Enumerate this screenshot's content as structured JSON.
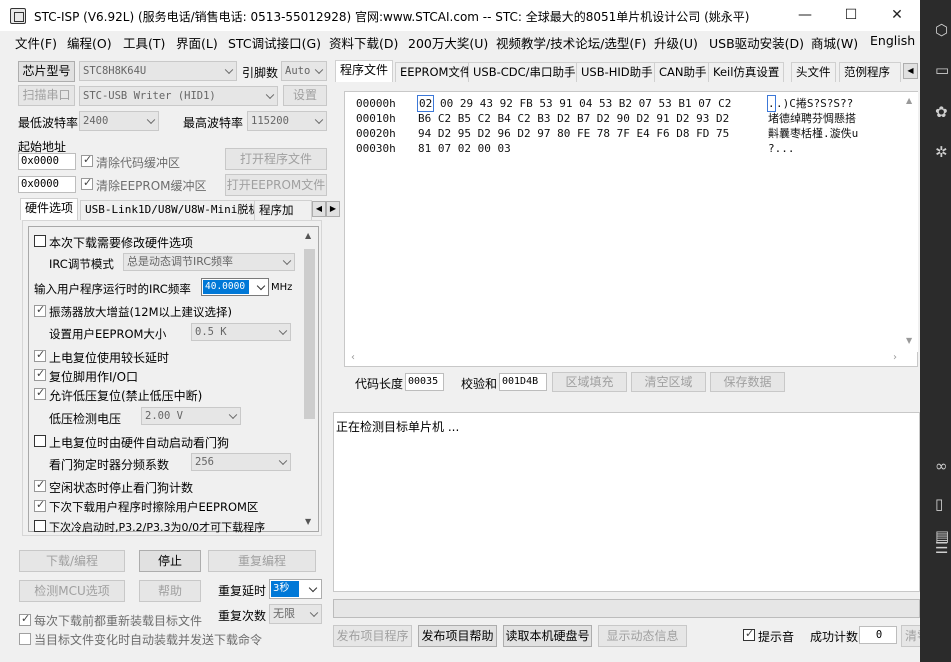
{
  "window": {
    "title": "STC-ISP (V6.92L) (服务电话/销售电话: 0513-55012928) 官网:www.STCAI.com  -- STC: 全球最大的8051单片机设计公司 (姚永平)",
    "minimize": "—",
    "maximize": "☐",
    "close": "✕"
  },
  "menu": [
    "文件(F)",
    "编程(O)",
    "工具(T)",
    "界面(L)",
    "STC调试接口(G)",
    "资料下载(D)",
    "200万大奖(U)",
    "视频教学/技术论坛/选型(F)",
    "升级(U)",
    "USB驱动安装(D)",
    "商城(W)",
    "English"
  ],
  "left": {
    "chip_button": "芯片型号",
    "chip_value": "STC8H8K64U",
    "pin_label": "引脚数",
    "pin_value": "Auto",
    "scan_button": "扫描串口",
    "port_value": "STC-USB Writer (HID1)",
    "settings_button": "设置",
    "min_baud_label": "最低波特率",
    "min_baud_value": "2400",
    "max_baud_label": "最高波特率",
    "max_baud_value": "115200",
    "start_addr_label": "起始地址",
    "addr1": "0x0000",
    "clear_code_label": "清除代码缓冲区",
    "open_prog_button": "打开程序文件",
    "addr2": "0x0000",
    "clear_eeprom_label": "清除EEPROM缓冲区",
    "open_eeprom_button": "打开EEPROM文件",
    "tabs": [
      "硬件选项",
      "USB-Link1D/U8W/U8W-Mini脱机",
      "程序加"
    ],
    "hw": {
      "opt1": "本次下载需要修改硬件选项",
      "irc_mode_label": "IRC调节模式",
      "irc_mode_value": "总是动态调节IRC频率",
      "irc_freq_label": "输入用户程序运行时的IRC频率",
      "irc_freq_value": "40.0000",
      "mhz": "MHz",
      "opt_osc": "振荡器放大增益(12M以上建议选择)",
      "eeprom_size_label": "设置用户EEPROM大小",
      "eeprom_size_value": "0.5 K",
      "opt_delay": "上电复位使用较长延时",
      "opt_io": "复位脚用作I/O口",
      "opt_lvr": "允许低压复位(禁止低压中断)",
      "lvd_label": "低压检测电压",
      "lvd_value": "2.00 V",
      "opt_wdt": "上电复位时由硬件自动启动看门狗",
      "wdt_label": "看门狗定时器分频系数",
      "wdt_value": "256",
      "opt_idle": "空闲状态时停止看门狗计数",
      "opt_erase": "下次下载用户程序时擦除用户EEPROM区",
      "opt_cold": "下次冷启动时,P3.2/P3.3为0/0才可下载程序"
    },
    "download_button": "下载/编程",
    "stop_button": "停止",
    "reprogram_button": "重复编程",
    "check_mcu_button": "检测MCU选项",
    "help_button": "帮助",
    "repeat_delay_label": "重复延时",
    "repeat_delay_value": "3秒",
    "repeat_count_label": "重复次数",
    "repeat_count_value": "无限",
    "reload_label": "每次下载前都重新装载目标文件",
    "auto_load_label": "当目标文件变化时自动装载并发送下载命令"
  },
  "right": {
    "tabs": [
      "程序文件",
      "EEPROM文件",
      "USB-CDC/串口助手",
      "USB-HID助手",
      "CAN助手",
      "Keil仿真设置",
      "头文件",
      "范例程序"
    ],
    "hex_rows": [
      {
        "addr": "00000h",
        "first": "02",
        "bytes": "00 29 43 92 FB 53 91 04 53 B2 07 53 B1 07 C2",
        "ascii_first": ".",
        "ascii": ".)C捲S?S?S??"
      },
      {
        "addr": "00010h",
        "bytes": "B6 C2 B5 C2 B4 C2 B3 D2 B7 D2 90 D2 91 D2 93 D2",
        "ascii": "堵德绰聘芬惆懸搭"
      },
      {
        "addr": "00020h",
        "bytes": "94 D2 95 D2 96 D2 97 80 FE 78 7F E4 F6 D8 FD 75",
        "ascii": "斢曩枣栝槿.漩佚u"
      },
      {
        "addr": "00030h",
        "bytes": "81 07 02 00 03",
        "ascii": "?..."
      }
    ],
    "code_len_label": "代码长度",
    "code_len_value": "00035",
    "checksum_label": "校验和",
    "checksum_value": "001D4B",
    "fill_button": "区域填充",
    "clear_button": "清空区域",
    "save_button": "保存数据",
    "log_text": "正在检测目标单片机 ...",
    "publish_prog_button": "发布项目程序",
    "publish_help_button": "发布项目帮助",
    "read_disk_button": "读取本机硬盘号",
    "show_dyn_button": "显示动态信息",
    "beep_label": "提示音",
    "success_label": "成功计数",
    "success_value": "0",
    "clear_count_button": "清零"
  },
  "colors": {
    "selection": "#0078d7",
    "accent_box": "#3c78d8"
  }
}
